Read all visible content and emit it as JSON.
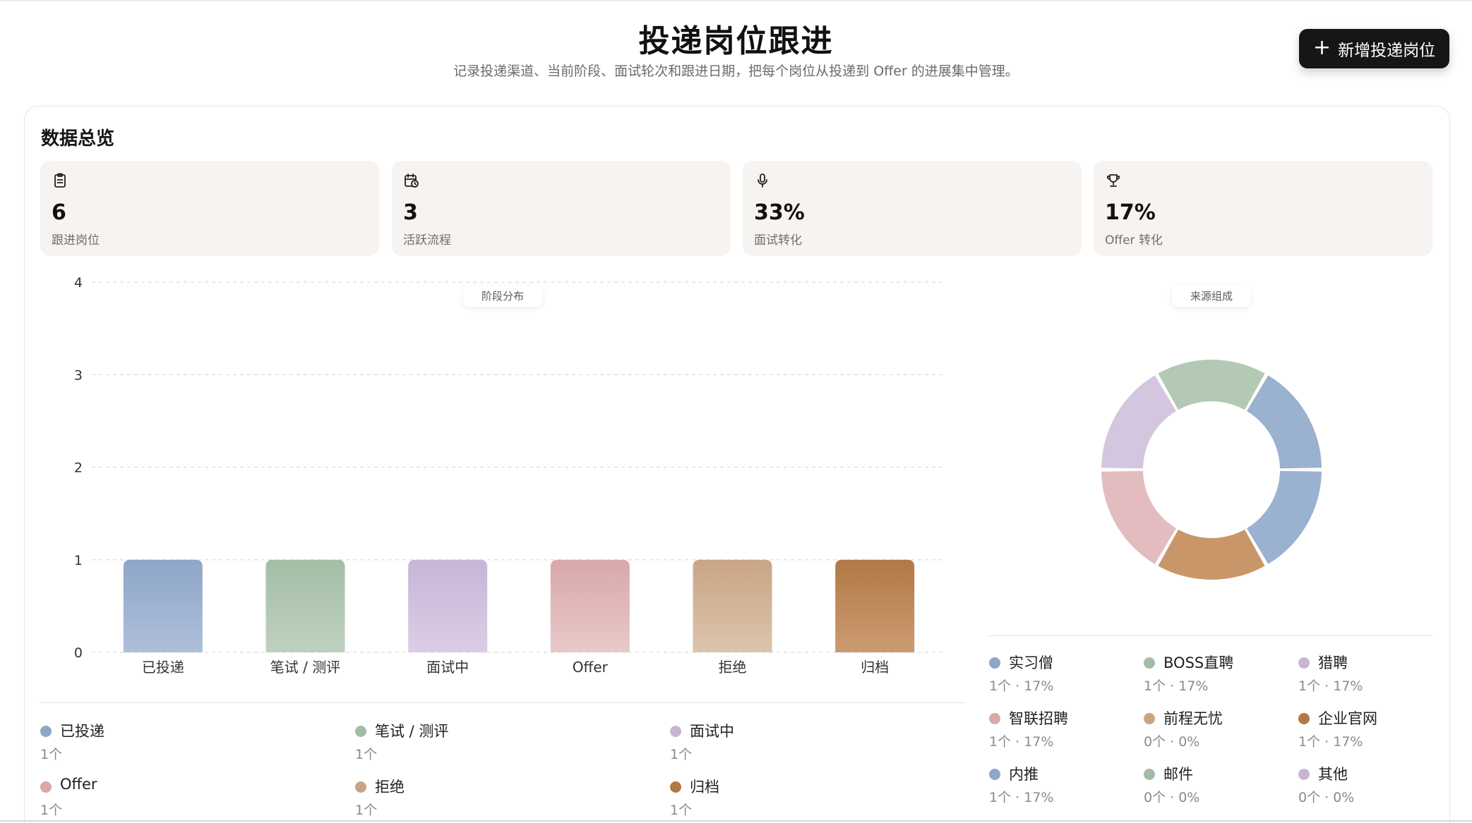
{
  "header": {
    "title": "投递岗位跟进",
    "subtitle": "记录投递渠道、当前阶段、面试轮次和跟进日期，把每个岗位从投递到 Offer 的进展集中管理。",
    "add_button_label": "新增投递岗位",
    "add_button_icon": "plus-icon"
  },
  "overview": {
    "title": "数据总览",
    "stats": [
      {
        "icon": "clipboard-icon",
        "value": "6",
        "label": "跟进岗位"
      },
      {
        "icon": "calendar-clock-icon",
        "value": "3",
        "label": "活跃流程"
      },
      {
        "icon": "microphone-icon",
        "value": "33%",
        "label": "面试转化"
      },
      {
        "icon": "trophy-icon",
        "value": "17%",
        "label": "Offer 转化"
      }
    ]
  },
  "stage_chart": {
    "pill_label": "阶段分布",
    "legend": [
      {
        "name": "已投递",
        "count": "1个",
        "color": "#8ea6c8"
      },
      {
        "name": "笔试 / 测评",
        "count": "1个",
        "color": "#a3bda5"
      },
      {
        "name": "面试中",
        "count": "1个",
        "color": "#c7b5d6"
      },
      {
        "name": "Offer",
        "count": "1个",
        "color": "#d9a8a9"
      },
      {
        "name": "拒绝",
        "count": "1个",
        "color": "#c9a585"
      },
      {
        "name": "归档",
        "count": "1个",
        "color": "#b27846"
      }
    ]
  },
  "source_chart": {
    "pill_label": "来源组成",
    "legend": [
      {
        "name": "实习僧",
        "count": "1个 · 17%",
        "color": "#8ea6c8"
      },
      {
        "name": "BOSS直聘",
        "count": "1个 · 17%",
        "color": "#a3bda5"
      },
      {
        "name": "猎聘",
        "count": "1个 · 17%",
        "color": "#c7b5d6"
      },
      {
        "name": "智联招聘",
        "count": "1个 · 17%",
        "color": "#d9a8a9"
      },
      {
        "name": "前程无忧",
        "count": "0个 · 0%",
        "color": "#c9a585"
      },
      {
        "name": "企业官网",
        "count": "1个 · 17%",
        "color": "#b27846"
      },
      {
        "name": "内推",
        "count": "1个 · 17%",
        "color": "#8ea6c8"
      },
      {
        "name": "邮件",
        "count": "0个 · 0%",
        "color": "#a3bda5"
      },
      {
        "name": "其他",
        "count": "0个 · 0%",
        "color": "#c7b5d6"
      }
    ]
  },
  "chart_data": [
    {
      "type": "bar",
      "title": "阶段分布",
      "categories": [
        "已投递",
        "笔试 / 测评",
        "面试中",
        "Offer",
        "拒绝",
        "归档"
      ],
      "values": [
        1,
        1,
        1,
        1,
        1,
        1
      ],
      "ylim": [
        0,
        4
      ],
      "yticks": [
        "0",
        "1",
        "2",
        "3",
        "4"
      ],
      "grid": true,
      "colors_top": [
        "#8ea6c8",
        "#a3bda5",
        "#c7b5d6",
        "#d9a8a9",
        "#c9a585",
        "#b27846"
      ],
      "colors_bottom": [
        "#aebfdb",
        "#bfd1bf",
        "#dccde6",
        "#e8c8c9",
        "#dcc4ad",
        "#cc9c72"
      ]
    },
    {
      "type": "pie",
      "title": "来源组成",
      "labels": [
        "内推",
        "企业官网",
        "智联招聘",
        "猎聘",
        "BOSS直聘",
        "实习僧"
      ],
      "values": [
        1,
        1,
        1,
        1,
        1,
        1
      ],
      "colors": [
        "#9ab1cf",
        "#c9966a",
        "#e2bcbe",
        "#d5c6e0",
        "#b3c9b3",
        "#9ab1cf"
      ],
      "donut": true
    }
  ]
}
